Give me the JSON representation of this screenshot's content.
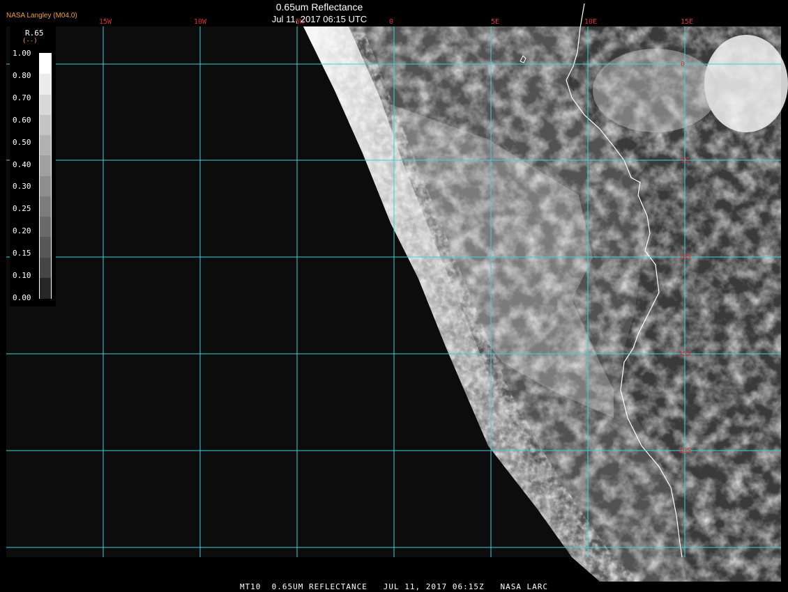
{
  "header": {
    "logo": "NASA Langley (M04.0)",
    "title": "0.65um Reflectance",
    "subtitle": "Jul 11, 2017 06:15 UTC"
  },
  "footer": {
    "caption": "MT10  0.65UM REFLECTANCE   JUL 11, 2017 06:15Z   NASA LARC"
  },
  "colorbar": {
    "title": "R.65",
    "unit": "(--)",
    "ticks": [
      "1.00",
      "0.80",
      "0.70",
      "0.60",
      "0.50",
      "0.40",
      "0.30",
      "0.25",
      "0.20",
      "0.15",
      "0.10",
      "0.00"
    ],
    "colors": [
      "#ffffff",
      "#ececec",
      "#d8d8d8",
      "#c4c4c4",
      "#b2b2b2",
      "#a0a0a0",
      "#8e8e8e",
      "#7c7c7c",
      "#6a6a6a",
      "#585858",
      "#464646",
      "#262626"
    ]
  },
  "grid": {
    "longitude_labels": [
      "15W",
      "10W",
      "5W",
      "0",
      "5E",
      "10E",
      "15E"
    ],
    "latitude_labels": [
      "0",
      "5S",
      "10S",
      "15S",
      "20S"
    ],
    "grid_color": "#40d0e0",
    "label_color": "#e03030",
    "coastline_color": "#ffffff"
  },
  "colors": {
    "background": "#000000",
    "ocean_dark": "#0c0c0c",
    "logo": "#f0a030"
  }
}
